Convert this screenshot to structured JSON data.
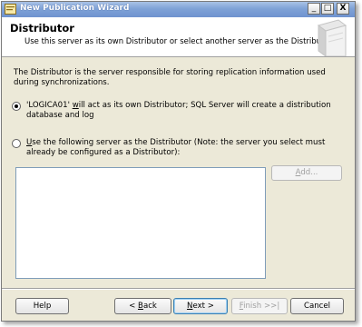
{
  "window": {
    "title": "New Publication Wizard"
  },
  "titlebar_buttons": {
    "minimize": "_",
    "maximize": "□",
    "close": "X"
  },
  "header": {
    "title": "Distributor",
    "subtitle": "Use this server as its own Distributor or select another server as the Distributor."
  },
  "description": "The Distributor is the server responsible for storing replication information used during synchronizations.",
  "options": {
    "own_distributor": {
      "selected": true,
      "text_pre": "'LOGICA01' ",
      "text_ul": "w",
      "text_post": "ill act as its own Distributor; SQL Server will create a distribution database and log"
    },
    "other_distributor": {
      "selected": false,
      "text_ul": "U",
      "text_post": "se the following server as the Distributor (Note: the server you select must already be configured as a Distributor):"
    }
  },
  "add_button": {
    "ul": "A",
    "rest": "dd..."
  },
  "footer": {
    "help": "Help",
    "back": {
      "pre": "< ",
      "ul": "B",
      "post": "ack"
    },
    "next": {
      "ul": "N",
      "post": "ext >"
    },
    "finish": {
      "ul": "F",
      "post": "inish >>|"
    },
    "cancel": "Cancel"
  },
  "colors": {
    "titlebar": "#7fa2d7",
    "dialog_bg": "#ece9d8",
    "accent": "#3c7fb1"
  },
  "icons": [
    "wizard-icon",
    "minimize-icon",
    "maximize-icon",
    "close-icon",
    "server-graphic-icon"
  ]
}
